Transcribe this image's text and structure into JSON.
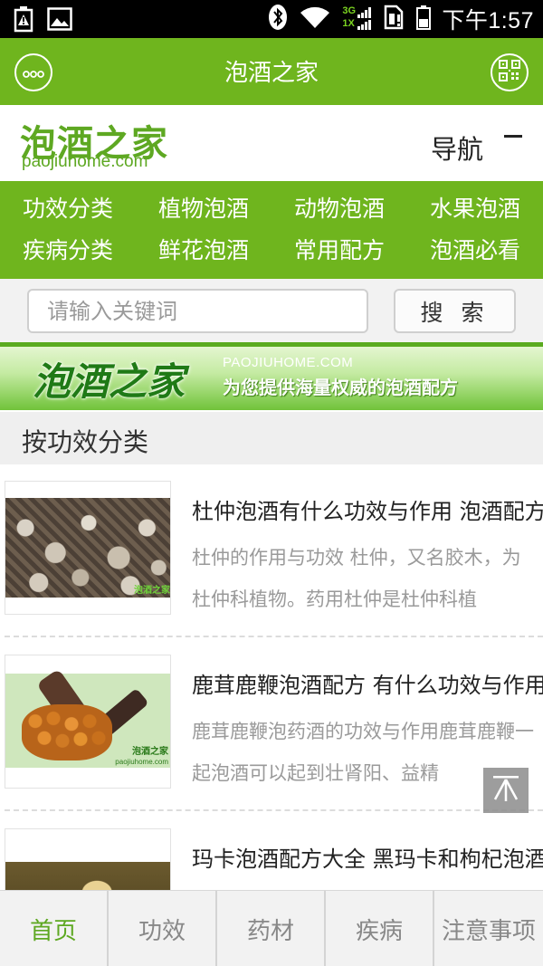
{
  "status_bar": {
    "time": "下午1:57",
    "network_label_top": "3G",
    "network_label_bottom": "1X",
    "icons": [
      "battery-alert-icon",
      "image-icon",
      "bluetooth-icon",
      "wifi-icon",
      "signal-icon",
      "sim-alert-icon",
      "battery-icon"
    ]
  },
  "header": {
    "title": "泡酒之家",
    "menu_icon": "more-dots-icon",
    "qr_icon": "qr-code-icon"
  },
  "brand": {
    "logo_cn": "泡酒之家",
    "logo_en": "paojiuhome.com",
    "nav_label": "导航",
    "nav_icon": "minus-icon"
  },
  "categories": [
    "功效分类",
    "植物泡酒",
    "动物泡酒",
    "水果泡酒",
    "疾病分类",
    "鲜花泡酒",
    "常用配方",
    "泡酒必看"
  ],
  "search": {
    "placeholder": "请输入关键词",
    "button_label": "搜 索"
  },
  "banner": {
    "title_cn": "泡酒之家",
    "site_en": "PAOJIUHOME.COM",
    "slogan": "为您提供海量权威的泡酒配方"
  },
  "section": {
    "title": "按功效分类"
  },
  "articles": [
    {
      "title": "杜仲泡酒有什么功效与作用 泡酒配方",
      "desc": "杜仲的作用与功效 杜仲，又名胶木，为杜仲科植物。药用杜仲是杜仲科植",
      "thumb_watermark": "泡酒之家"
    },
    {
      "title": "鹿茸鹿鞭泡酒配方 有什么功效与作用",
      "desc": "鹿茸鹿鞭泡药酒的功效与作用鹿茸鹿鞭一起泡酒可以起到壮肾阳、益精",
      "thumb_watermark": "泡酒之家",
      "thumb_watermark_en": "paojiuhome.com"
    },
    {
      "title": "玛卡泡酒配方大全 黑玛卡和枸杞泡酒",
      "desc": ""
    }
  ],
  "scroll_top_icon": "back-to-top-icon",
  "bottom_nav": {
    "active": 0,
    "tabs": [
      "首页",
      "功效",
      "药材",
      "疾病",
      "注意事项"
    ]
  },
  "colors": {
    "brand_green": "#6fb51e",
    "logo_green": "#5ea822",
    "text_gray": "#9a9a9a"
  }
}
